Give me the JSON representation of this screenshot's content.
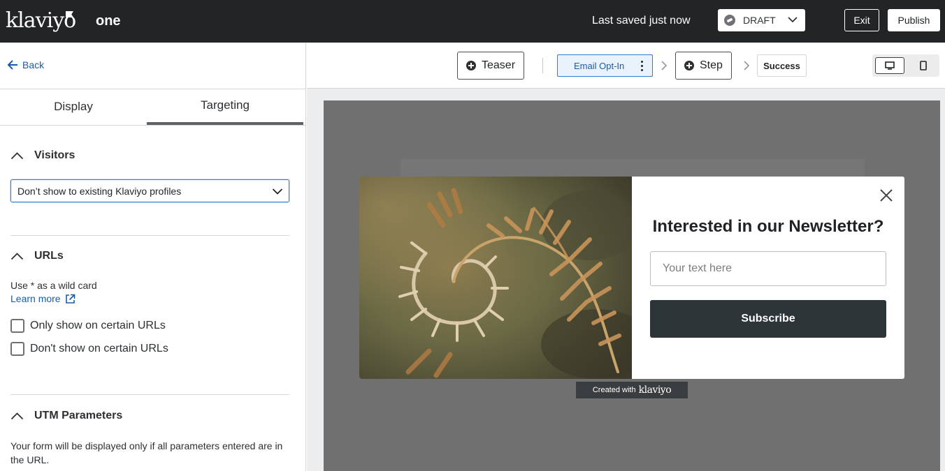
{
  "topbar": {
    "logo": "klaviyo",
    "form_name": "one",
    "save_status": "Last saved just now",
    "status_label": "DRAFT",
    "exit_label": "Exit",
    "publish_label": "Publish"
  },
  "left_panel": {
    "back_label": "Back",
    "tabs": [
      {
        "label": "Display",
        "active": false
      },
      {
        "label": "Targeting",
        "active": true
      }
    ],
    "visitors": {
      "title": "Visitors",
      "select_value": "Don’t show to existing Klaviyo profiles"
    },
    "urls": {
      "title": "URLs",
      "hint": "Use * as a wild card",
      "learn_more": "Learn more",
      "options": [
        {
          "label": "Only show on certain URLs",
          "checked": false
        },
        {
          "label": "Don't show on certain URLs",
          "checked": false
        }
      ]
    },
    "utm": {
      "title": "UTM Parameters",
      "description": "Your form will be displayed only if all parameters entered are in the URL."
    }
  },
  "steps": {
    "teaser": "Teaser",
    "email_opt_in": "Email Opt-In",
    "step": "Step",
    "success": "Success",
    "device": "desktop"
  },
  "preview": {
    "title": "Interested in our Newsletter?",
    "input_placeholder": "Your text here",
    "subscribe_label": "Subscribe",
    "badge_prefix": "Created with",
    "badge_brand": "klaviyo"
  },
  "colors": {
    "topbar_bg": "#232426",
    "link_blue": "#1a5ba8",
    "focus_blue": "#2f7ad6",
    "button_dark": "#2e3538",
    "preview_overlay": "#707070"
  },
  "icons": [
    "back-arrow-icon",
    "chevron-down-icon",
    "chevron-up-icon",
    "external-link-icon",
    "plus-circle-icon",
    "more-vertical-icon",
    "chevron-right-icon",
    "desktop-icon",
    "mobile-icon",
    "close-icon",
    "status-icon"
  ]
}
